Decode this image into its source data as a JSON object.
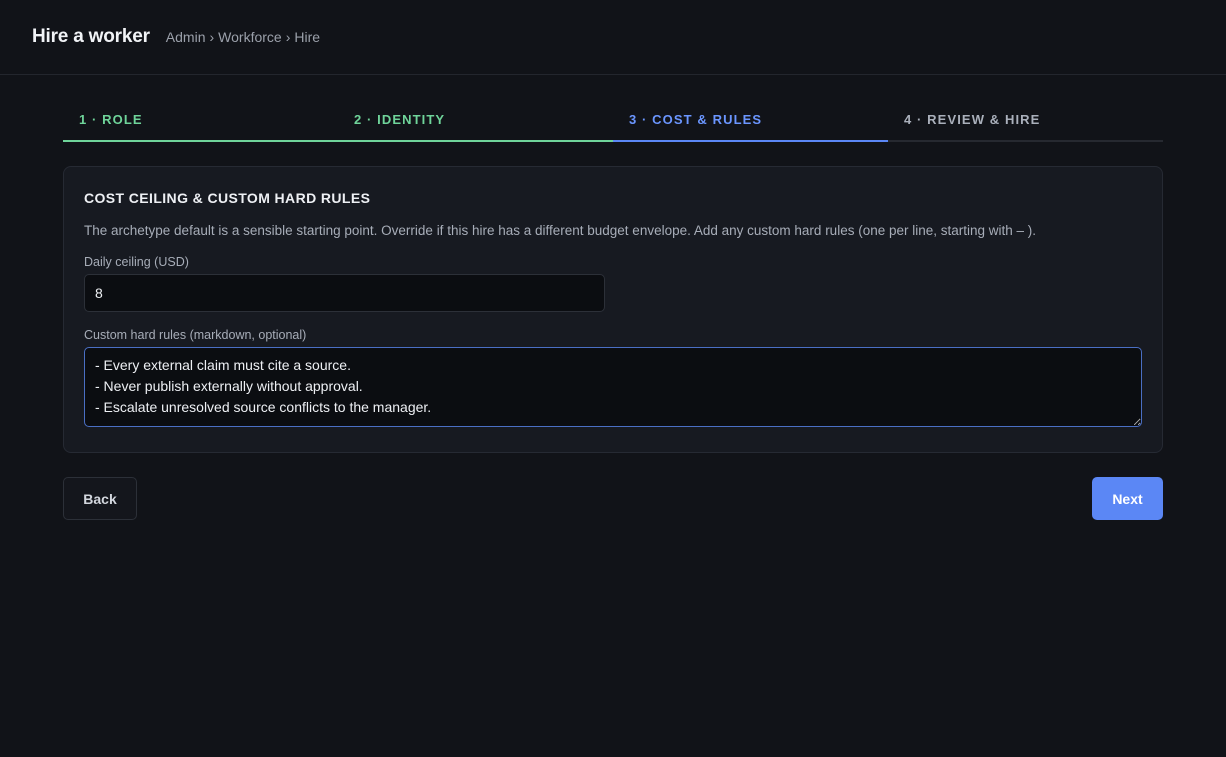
{
  "header": {
    "title": "Hire a worker",
    "breadcrumb": [
      "Admin",
      "Workforce",
      "Hire"
    ],
    "separator": "›"
  },
  "steps": [
    {
      "label": "1 · ROLE",
      "state": "done"
    },
    {
      "label": "2 · IDENTITY",
      "state": "done"
    },
    {
      "label": "3 · COST & RULES",
      "state": "active"
    },
    {
      "label": "4 · REVIEW & HIRE",
      "state": "pending"
    }
  ],
  "card": {
    "title": "COST CEILING & CUSTOM HARD RULES",
    "description": "The archetype default is a sensible starting point. Override if this hire has a different budget envelope. Add any custom hard rules (one per line, starting with –  ).",
    "daily_ceiling": {
      "label": "Daily ceiling (USD)",
      "value": "8"
    },
    "custom_rules": {
      "label": "Custom hard rules (markdown, optional)",
      "value": "- Every external claim must cite a source.\n- Never publish externally without approval.\n- Escalate unresolved source conflicts to the manager."
    }
  },
  "actions": {
    "back_label": "Back",
    "next_label": "Next"
  },
  "colors": {
    "accent": "#5b87f5",
    "done": "#6fd49a",
    "background": "#111318"
  }
}
